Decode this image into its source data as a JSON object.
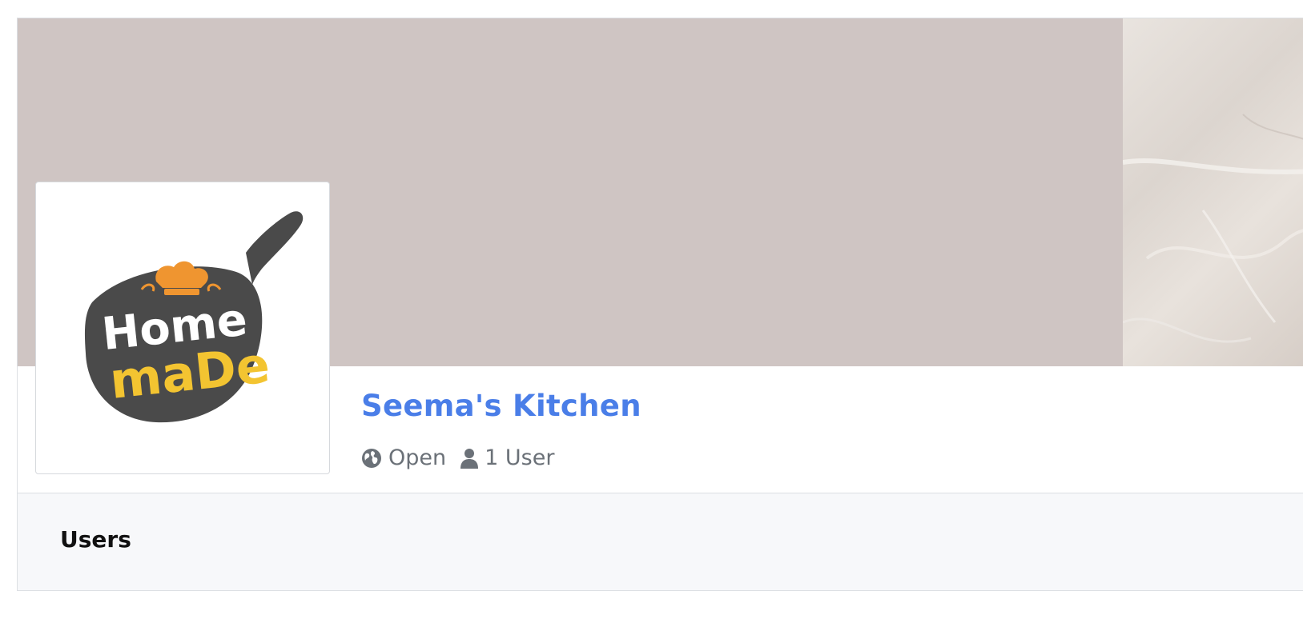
{
  "space": {
    "name": "Seema's Kitchen",
    "logo_text_line1": "Home",
    "logo_text_line2": "maDe",
    "visibility": "Open",
    "members": "1 User",
    "visibility_icon": "globe-icon",
    "members_icon": "user-icon"
  },
  "tabs": [
    {
      "label": "Users"
    }
  ],
  "colors": {
    "title": "#4a7ee8",
    "cover": "#cfc5c3",
    "logo_pan": "#4a4a4a",
    "logo_accent": "#f3c431",
    "logo_hat": "#ef9530"
  }
}
